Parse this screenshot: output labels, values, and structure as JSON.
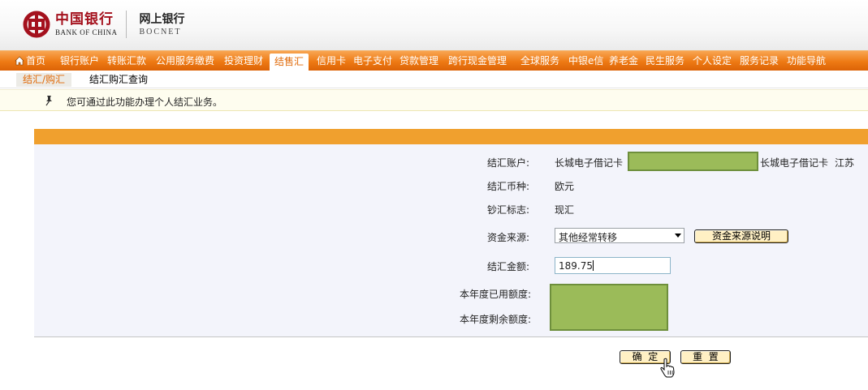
{
  "header": {
    "logo_cn": "中国银行",
    "logo_en": "BANK OF CHINA",
    "product_cn": "网上银行",
    "product_en": "BOCNET"
  },
  "nav": {
    "items": [
      {
        "label": "首页",
        "icon": "home-icon"
      },
      {
        "label": "银行账户"
      },
      {
        "label": "转账汇款"
      },
      {
        "label": "公用服务缴费"
      },
      {
        "label": "投资理财"
      },
      {
        "label": "结售汇",
        "active": true
      },
      {
        "label": "信用卡"
      },
      {
        "label": "电子支付"
      },
      {
        "label": "贷款管理"
      },
      {
        "label": "跨行现金管理"
      },
      {
        "label": "全球服务"
      },
      {
        "label": "中银e信"
      },
      {
        "label": "养老金"
      },
      {
        "label": "民生服务"
      },
      {
        "label": "个人设定"
      },
      {
        "label": "服务记录"
      },
      {
        "label": "功能导航"
      }
    ]
  },
  "subnav": {
    "items": [
      {
        "label": "结汇/购汇",
        "active": true
      },
      {
        "label": "结汇购汇查询"
      }
    ]
  },
  "notice": {
    "icon": "pin-icon",
    "text": "您可通过此功能办理个人结汇业务。"
  },
  "form": {
    "account_label": "结汇账户:",
    "account_type": "长城电子借记卡",
    "account_card_type": "长城电子借记卡",
    "account_region": "江苏",
    "currency_label": "结汇币种:",
    "currency_value": "欧元",
    "cash_flag_label": "钞汇标志:",
    "cash_flag_value": "现汇",
    "source_label": "资金来源:",
    "source_selected": "其他经常转移",
    "source_help_button": "资金来源说明",
    "amount_label": "结汇金额:",
    "amount_value": "189.75",
    "used_quota_label": "本年度已用额度:",
    "remaining_quota_label": "本年度剩余额度:",
    "confirm_button": "确  定",
    "reset_button": "重  置"
  },
  "colors": {
    "brand_red": "#a4111d",
    "nav_orange": "#ee7a14",
    "panel_bar": "#f0a02e",
    "redaction": "#9bbb59",
    "button_fill": "#fff0c4"
  }
}
